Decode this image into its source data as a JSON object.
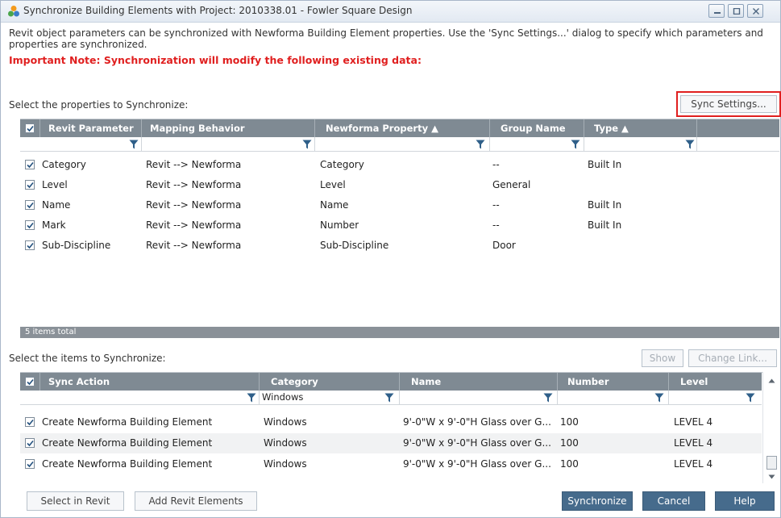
{
  "window": {
    "title": "Synchronize Building Elements with Project: 2010338.01 - Fowler Square Design",
    "controls": [
      "minimize",
      "maximize",
      "close"
    ]
  },
  "description": "Revit object parameters can be synchronized with Newforma Building Element properties. Use the 'Sync Settings...' dialog to specify which parameters and properties are synchronized.",
  "important_note": "Important Note: Synchronization will modify the following existing data:",
  "properties_section": {
    "label": "Select the properties to Synchronize:",
    "sync_settings_button": "Sync Settings...",
    "columns": [
      "Revit Parameter",
      "Mapping Behavior",
      "Newforma Property ▲",
      "Group Name",
      "Type ▲"
    ],
    "rows": [
      {
        "checked": true,
        "revit_parameter": "Category",
        "mapping": "Revit --> Newforma",
        "property": "Category",
        "group": "--",
        "type": "Built In"
      },
      {
        "checked": true,
        "revit_parameter": "Level",
        "mapping": "Revit --> Newforma",
        "property": "Level",
        "group": "General",
        "type": ""
      },
      {
        "checked": true,
        "revit_parameter": "Name",
        "mapping": "Revit --> Newforma",
        "property": "Name",
        "group": "--",
        "type": "Built In"
      },
      {
        "checked": true,
        "revit_parameter": "Mark",
        "mapping": "Revit --> Newforma",
        "property": "Number",
        "group": "--",
        "type": "Built In"
      },
      {
        "checked": true,
        "revit_parameter": "Sub-Discipline",
        "mapping": "Revit --> Newforma",
        "property": "Sub-Discipline",
        "group": "Door",
        "type": ""
      }
    ],
    "status": "5 items total"
  },
  "items_section": {
    "label": "Select the items to Synchronize:",
    "show_button": "Show",
    "change_link_button": "Change Link...",
    "columns": [
      "Sync Action",
      "Category",
      "Name",
      "Number",
      "Level"
    ],
    "category_filter": "Windows",
    "rows": [
      {
        "checked": true,
        "action": "Create Newforma Building Element",
        "category": "Windows",
        "name": "9'-0\"W x 9'-0\"H Glass over G...",
        "number": "100",
        "level": "LEVEL 4"
      },
      {
        "checked": true,
        "action": "Create Newforma Building Element",
        "category": "Windows",
        "name": "9'-0\"W x 9'-0\"H Glass over G...",
        "number": "100",
        "level": "LEVEL 4"
      },
      {
        "checked": true,
        "action": "Create Newforma Building Element",
        "category": "Windows",
        "name": "9'-0\"W x 9'-0\"H Glass over G...",
        "number": "100",
        "level": "LEVEL 4"
      }
    ]
  },
  "footer": {
    "select_in_revit": "Select in Revit",
    "add_revit_elements": "Add Revit Elements",
    "synchronize": "Synchronize",
    "cancel": "Cancel",
    "help": "Help"
  },
  "colors": {
    "accent": "#466b8c",
    "header": "#7f8a93",
    "warning": "#e01f1f"
  },
  "icons": [
    "app-icon",
    "filter-funnel-icon",
    "checkbox-checked-icon",
    "scroll-up-icon",
    "scroll-down-icon"
  ]
}
